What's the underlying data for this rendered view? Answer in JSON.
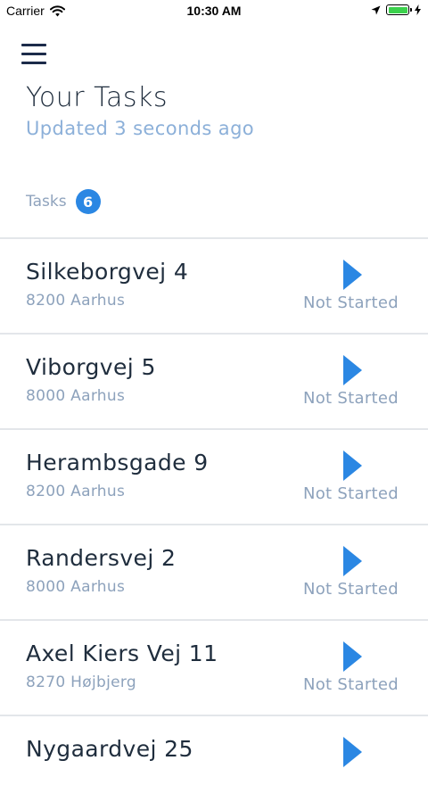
{
  "status_bar": {
    "carrier": "Carrier",
    "time": "10:30 AM",
    "battery_level": 1.0,
    "icons": [
      "wifi-icon",
      "location-arrow-icon",
      "battery-icon",
      "charging-bolt-icon"
    ]
  },
  "header": {
    "menu_icon": "hamburger-menu-icon",
    "title": "Your Tasks",
    "updated": "Updated 3 seconds ago"
  },
  "tasks_section": {
    "label": "Tasks",
    "count": "6"
  },
  "colors": {
    "accent": "#2b87e3",
    "title_text": "#1f2d3d",
    "muted_text": "#8da2bc",
    "updated_text": "#8cb0d9",
    "divider": "#e3e6ea"
  },
  "tasks": [
    {
      "name": "Silkeborgvej 4",
      "city": "8200 Aarhus",
      "status": "Not Started"
    },
    {
      "name": "Viborgvej 5",
      "city": "8000 Aarhus",
      "status": "Not Started"
    },
    {
      "name": "Herambsgade 9",
      "city": "8200 Aarhus",
      "status": "Not Started"
    },
    {
      "name": "Randersvej 2",
      "city": "8000 Aarhus",
      "status": "Not Started"
    },
    {
      "name": "Axel Kiers Vej 11",
      "city": "8270 Højbjerg",
      "status": "Not Started"
    },
    {
      "name": "Nygaardvej 25",
      "city": "",
      "status": ""
    }
  ]
}
